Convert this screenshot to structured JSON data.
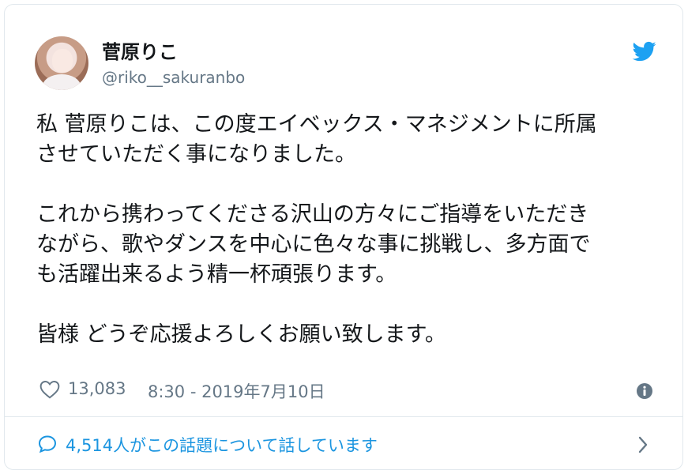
{
  "user": {
    "display_name": "菅原りこ",
    "handle": "@riko__sakuranbo"
  },
  "tweet": {
    "lines": [
      "私 菅原りこは、この度エイベックス・マネジメントに所属",
      "させていただく事になりました。",
      "",
      "これから携わってくださる沢山の方々にご指導をいただき",
      "ながら、歌やダンスを中心に色々な事に挑戦し、多方面で",
      "も活躍出来るよう精一杯頑張ります。",
      "",
      "皆様 どうぞ応援よろしくお願い致します。"
    ]
  },
  "meta": {
    "likes": "13,083",
    "timestamp": "8:30 - 2019年7月10日"
  },
  "footer": {
    "conversation": "4,514人がこの話題について話しています"
  },
  "icons": {
    "brand": "twitter-bird-icon",
    "like": "heart-outline-icon",
    "info": "info-icon",
    "reply": "speech-bubble-icon",
    "chevron": "chevron-right-icon"
  },
  "colors": {
    "twitter_blue": "#1da1f2",
    "link_blue": "#1b95e0",
    "secondary_text": "#657786",
    "border": "#e1e8ed"
  }
}
